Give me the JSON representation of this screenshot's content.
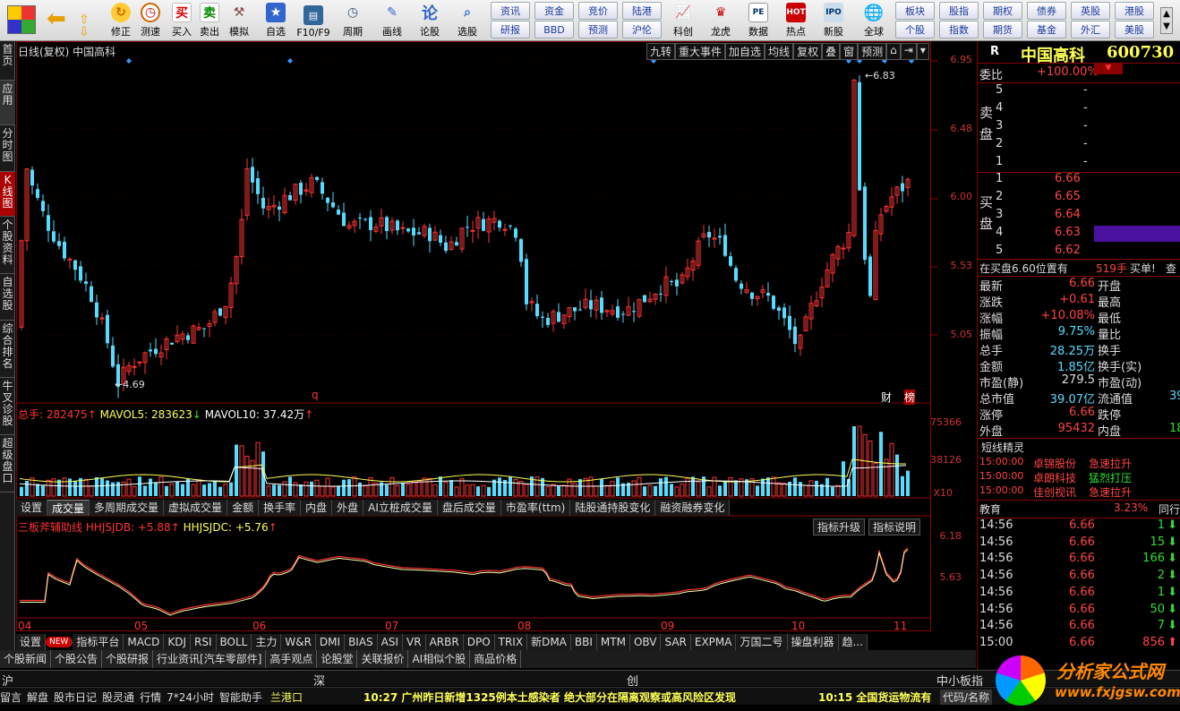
{
  "toolbar": {
    "buttons": [
      {
        "label": "修正"
      },
      {
        "label": "测速"
      },
      {
        "label": "买入"
      },
      {
        "label": "卖出"
      },
      {
        "label": "模拟"
      },
      {
        "label": "自选"
      },
      {
        "label": "F10/F9"
      },
      {
        "label": "周期"
      },
      {
        "label": "画线"
      },
      {
        "label": "论股"
      },
      {
        "label": "选股"
      },
      {
        "label": "科创"
      },
      {
        "label": "龙虎"
      },
      {
        "label": "数据"
      },
      {
        "label": "热点"
      },
      {
        "label": "新股"
      },
      {
        "label": "全球"
      }
    ],
    "small_buttons": [
      "资讯",
      "资金",
      "竞价",
      "陆港",
      "研报",
      "BBD",
      "预测",
      "沪伦",
      "板块",
      "股指",
      "期权",
      "债券",
      "英股",
      "港股",
      "个股",
      "指数",
      "期货",
      "基金",
      "外汇",
      "美股"
    ]
  },
  "left_tabs": [
    "首页",
    "应用",
    "分时图",
    "K线图",
    "个股资料",
    "自选股",
    "综合排名",
    "牛叉诊股",
    "超级盘口"
  ],
  "chart": {
    "title": "日线(复权)  中国高科",
    "top_buttons": [
      "九转",
      "重大事件",
      "加自选",
      "均线",
      "复权",
      "叠",
      "窗",
      "预测"
    ],
    "price_axis": [
      "6.95",
      "6.48",
      "6.00",
      "5.53",
      "5.05"
    ],
    "high_marker": "6.83",
    "low_marker": "4.69",
    "badge_q": "q",
    "badge_cai": "财",
    "badge_bang": "榜",
    "vol_header": {
      "total": "总手: 282475",
      "ma5": "MAVOL5: 283623",
      "ma10": "MAVOL10: 37.42万"
    },
    "vol_axis": [
      "75366",
      "38126"
    ],
    "vol_unit": "X10",
    "mid_tabs": [
      "设置",
      "成交量",
      "多周期成交量",
      "虚拟成交量",
      "金额",
      "换手率",
      "内盘",
      "外盘",
      "AI立桩成交量",
      "盘后成交量",
      "市盈率(ttm)",
      "陆股通持股变化",
      "融资融券变化"
    ],
    "ind_header": {
      "name": "三板斧辅助线",
      "a": "HHJSJDB: +5.88",
      "b": "HHJSJDC: +5.76"
    },
    "ind_buttons": [
      "指标升级",
      "指标说明"
    ],
    "ind_axis": [
      "6.18",
      "5.63"
    ],
    "months": [
      "04",
      "05",
      "06",
      "07",
      "08",
      "09",
      "10",
      "11"
    ],
    "bottom_tabs": [
      "设置",
      "NEW",
      "指标平台",
      "MACD",
      "KDJ",
      "RSI",
      "BOLL",
      "主力",
      "W&R",
      "DMI",
      "BIAS",
      "ASI",
      "VR",
      "ARBR",
      "DPO",
      "TRIX",
      "新DMA",
      "BBI",
      "MTM",
      "OBV",
      "SAR",
      "EXPMA",
      "万国二号",
      "操盘利器",
      "趋..."
    ]
  },
  "right": {
    "code_prefix": "R",
    "name": "中国高科",
    "code": "600730",
    "weibi_label": "委比",
    "weibi_value": "+100.00%",
    "sell_label": "卖盘",
    "buy_label": "买盘",
    "sell": [
      {
        "n": "5",
        "p": "-"
      },
      {
        "n": "4",
        "p": "-"
      },
      {
        "n": "3",
        "p": "-"
      },
      {
        "n": "2",
        "p": "-"
      },
      {
        "n": "1",
        "p": "-"
      }
    ],
    "buy": [
      {
        "n": "1",
        "p": "6.66"
      },
      {
        "n": "2",
        "p": "6.65"
      },
      {
        "n": "3",
        "p": "6.64"
      },
      {
        "n": "4",
        "p": "6.63"
      },
      {
        "n": "5",
        "p": "6.62"
      }
    ],
    "buy_note": "在买盘6.60位置有",
    "buy_note_qty": "519手",
    "buy_note_tag": "买单!",
    "buy_note_tail": "查",
    "quote": [
      {
        "k": "最新",
        "v": "6.66",
        "k2": "开盘"
      },
      {
        "k": "涨跌",
        "v": "+0.61",
        "k2": "最高"
      },
      {
        "k": "涨幅",
        "v": "+10.08%",
        "k2": "最低"
      },
      {
        "k": "振幅",
        "v": "9.75%",
        "k2": "量比"
      },
      {
        "k": "总手",
        "v": "28.25万",
        "k2": "换手"
      },
      {
        "k": "金额",
        "v": "1.85亿",
        "k2": "换手(实)"
      },
      {
        "k": "市盈(静)",
        "v": "279.5",
        "k2": "市盈(动)"
      },
      {
        "k": "总市值",
        "v": "39.07亿",
        "k2": "流通值",
        "v2": "39"
      },
      {
        "k": "涨停",
        "v": "6.66",
        "k2": "跌停"
      },
      {
        "k": "外盘",
        "v": "95432",
        "k2": "内盘",
        "v2": "18"
      }
    ],
    "short_title": "短线精灵",
    "short": [
      {
        "t": "15:00:00",
        "s": "卓锦股份",
        "e": "急速拉升"
      },
      {
        "t": "15:00:00",
        "s": "卓朗科技",
        "e": "猛烈打压"
      },
      {
        "t": "15:00:00",
        "s": "佳创视讯",
        "e": "急速拉升"
      }
    ],
    "sector": "教育",
    "sector_pct": "3.23%",
    "sector_tail": "同行",
    "ticks": [
      {
        "t": "14:56",
        "p": "6.66",
        "v": "1"
      },
      {
        "t": "14:56",
        "p": "6.66",
        "v": "15"
      },
      {
        "t": "14:56",
        "p": "6.66",
        "v": "166"
      },
      {
        "t": "14:56",
        "p": "6.66",
        "v": "2"
      },
      {
        "t": "14:56",
        "p": "6.66",
        "v": "1"
      },
      {
        "t": "14:56",
        "p": "6.66",
        "v": "50"
      },
      {
        "t": "14:56",
        "p": "6.66",
        "v": "7"
      },
      {
        "t": "15:00",
        "p": "6.66",
        "v": "856"
      }
    ]
  },
  "newsbar": [
    "个股新闻",
    "个股公告",
    "个股研报",
    "行业资讯[汽车零部件]",
    "高手观点",
    "论股堂",
    "关联报价",
    "AI相似个股",
    "商品价格"
  ],
  "idxbar": {
    "a": "沪",
    "b": "深",
    "c": "创",
    "d": "中小板指"
  },
  "status": {
    "items": [
      "留言",
      "解盘",
      "股市日记",
      "股灵通",
      "行情",
      "7*24小时",
      "智能助手"
    ],
    "port": "兰港口",
    "news1": "10:27 广州昨日新增1325例本土感染者 绝大部分在隔离观察或高风险区发现",
    "news2": "10:15 全国货运物流有",
    "tail": "代码/名称"
  },
  "logo": {
    "text": "分析家公式网",
    "url": "www.fxjgsw.com"
  },
  "colors": {
    "up": "#ff3333",
    "down": "#55ddff",
    "yellow": "#ffff55"
  }
}
